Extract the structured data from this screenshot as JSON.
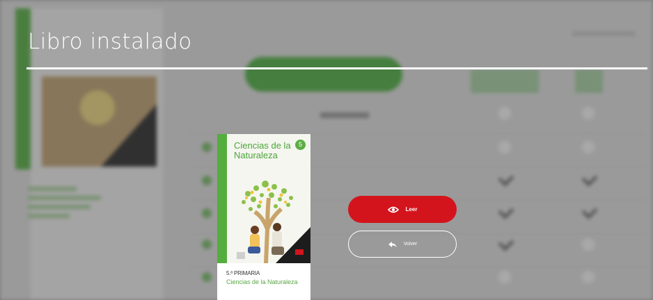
{
  "overlay": {
    "title": "Libro instalado"
  },
  "book": {
    "cover_title": "Ciencias de la Naturaleza",
    "badge": "5",
    "level": "5.º PRIMARIA",
    "subject": "Ciencias de la Naturaleza"
  },
  "actions": {
    "read_label": "Leer",
    "back_label": "Volver"
  },
  "colors": {
    "primary_red": "#d3141c",
    "brand_green": "#4ea83a",
    "white": "#ffffff"
  },
  "icons": {
    "read": "eye-icon",
    "back": "reply-arrow-icon"
  }
}
